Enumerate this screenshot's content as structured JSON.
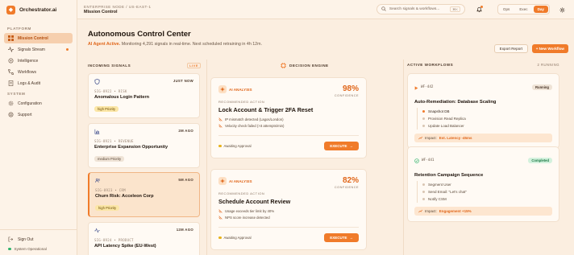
{
  "app": {
    "name": "Orchestrator.ai"
  },
  "sidebar": {
    "platform_label": "PLATFORM",
    "system_label": "SYSTEM",
    "items": [
      {
        "label": "Mission Control",
        "icon": "grid-icon"
      },
      {
        "label": "Signals Stream",
        "icon": "signal-icon"
      },
      {
        "label": "Intelligence",
        "icon": "brain-icon"
      },
      {
        "label": "Workflows",
        "icon": "workflow-icon"
      },
      {
        "label": "Logs & Audit",
        "icon": "document-icon"
      }
    ],
    "system_items": [
      {
        "label": "Configuration",
        "icon": "gear-icon"
      },
      {
        "label": "Support",
        "icon": "help-icon"
      }
    ],
    "sign_out": "Sign Out",
    "status": "System Operational"
  },
  "topbar": {
    "node": "ENTERPRISE NODE / US-EAST-1",
    "title": "Mission Control",
    "search_placeholder": "Search signals & workflows...",
    "search_kbd": "⌘K",
    "modes": [
      "Ops",
      "Exec",
      "Day"
    ],
    "active_mode": "Day"
  },
  "header": {
    "title": "Autonomous Control Center",
    "status_hl": "AI Agent Active.",
    "status_rest": " Monitoring 4,291 signals in real-time. Next scheduled retraining in 4h 12m.",
    "export_label": "Export Report",
    "new_label": "+ New Workflow"
  },
  "incoming": {
    "heading": "INCOMING SIGNALS",
    "live": "LIVE",
    "signals": [
      {
        "time": "JUST NOW",
        "id": "SIG-8922 • RISK",
        "title": "Anomalous Login Pattern",
        "priority": "high Priority",
        "icon": "shield-icon"
      },
      {
        "time": "2M AGO",
        "id": "SIG-8921 • REVENUE",
        "title": "Enterprise Expansion Opportunity",
        "priority": "medium Priority",
        "icon": "chart-icon"
      },
      {
        "time": "5M AGO",
        "id": "SIG-8923 • CRM",
        "title": "Churn Risk: Acceleon Corp",
        "priority": "high Priority",
        "icon": "users-icon"
      },
      {
        "time": "12M AGO",
        "id": "SIG-8924 • PRODUCT",
        "title": "API Latency Spike (EU-West)",
        "priority": "",
        "icon": "pulse-icon"
      }
    ]
  },
  "decision": {
    "heading": "DECISION ENGINE",
    "cards": [
      {
        "badge": "AI ANALYSIS",
        "confidence": "98%",
        "conf_label": "CONFIDENCE",
        "rec_label": "RECOMMENDED ACTION",
        "title": "Lock Account & Trigger 2FA Reset",
        "reasons": [
          "IP mismatch detected (Lagos/London)",
          "Velocity check failed (>3 attempts/min)"
        ],
        "status": "Awaiting Approval",
        "action": "EXECUTE"
      },
      {
        "badge": "AI ANALYSIS",
        "confidence": "82%",
        "conf_label": "CONFIDENCE",
        "rec_label": "RECOMMENDED ACTION",
        "title": "Schedule Account Review",
        "reasons": [
          "Usage exceeds tier limit by 40%",
          "NPS score increase detected"
        ],
        "status": "Awaiting Approval",
        "action": "EXECUTE"
      }
    ]
  },
  "workflows": {
    "heading": "ACTIVE WORKFLOWS",
    "count": "2 RUNNING",
    "items": [
      {
        "id": "WF-442",
        "status": "Running",
        "title": "Auto-Remediation: Database Scaling",
        "steps": [
          "Snapshot DB",
          "Provision Read Replica",
          "Update Load Balancer"
        ],
        "done_steps": 1,
        "impact_label": "Impact:",
        "impact_value": "Est. Latency -45ms"
      },
      {
        "id": "WF-441",
        "status": "Completed",
        "title": "Retention Campaign Sequence",
        "steps": [
          "Segment User",
          "Send Email: \"Let's chat\"",
          "Notify CSM"
        ],
        "done_steps": 0,
        "impact_label": "Impact:",
        "impact_value": "Engagement +15%"
      }
    ]
  },
  "colors": {
    "accent": "#f07b2a",
    "success": "#2fb36b",
    "warning": "#e8b21a"
  }
}
